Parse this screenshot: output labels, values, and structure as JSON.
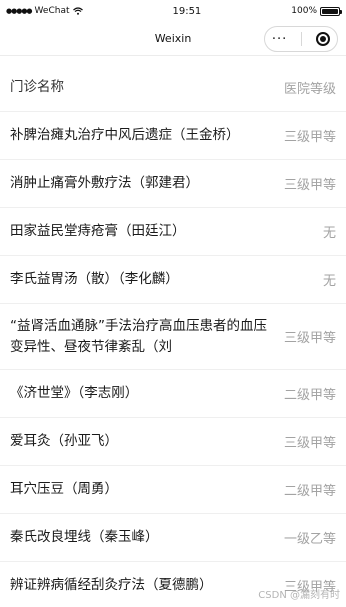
{
  "status_bar": {
    "carrier": "WeChat",
    "signal": "●●●●●",
    "time": "19:51",
    "battery_percent": "100%",
    "battery_level": 1.0
  },
  "nav": {
    "title": "Weixin",
    "more_icon": "···",
    "close_icon": "target-icon"
  },
  "table": {
    "header": {
      "name": "门诊名称",
      "level": "医院等级"
    },
    "rows": [
      {
        "name": "补脾治瘫丸治疗中风后遗症（王金桥）",
        "level": "三级甲等"
      },
      {
        "name": "消肿止痛膏外敷疗法（郭建君）",
        "level": "三级甲等"
      },
      {
        "name": "田家益民堂痔疮膏（田廷江）",
        "level": "无"
      },
      {
        "name": "李氏益胃汤（散）（李化麟）",
        "level": "无"
      },
      {
        "name": "“益肾活血通脉”手法治疗高血压患者的血压变异性、昼夜节律紊乱（刘",
        "level": "三级甲等"
      },
      {
        "name": "《济世堂》（李志刚）",
        "level": "二级甲等"
      },
      {
        "name": "爱耳灸（孙亚飞）",
        "level": "三级甲等"
      },
      {
        "name": "耳穴压豆（周勇）",
        "level": "二级甲等"
      },
      {
        "name": "秦氏改良埋线（秦玉峰）",
        "level": "一级乙等"
      },
      {
        "name": "辨证辨病循经刮灸疗法（夏德鹏）",
        "level": "三级甲等"
      }
    ]
  },
  "watermark": "CSDN @漏刻有时"
}
